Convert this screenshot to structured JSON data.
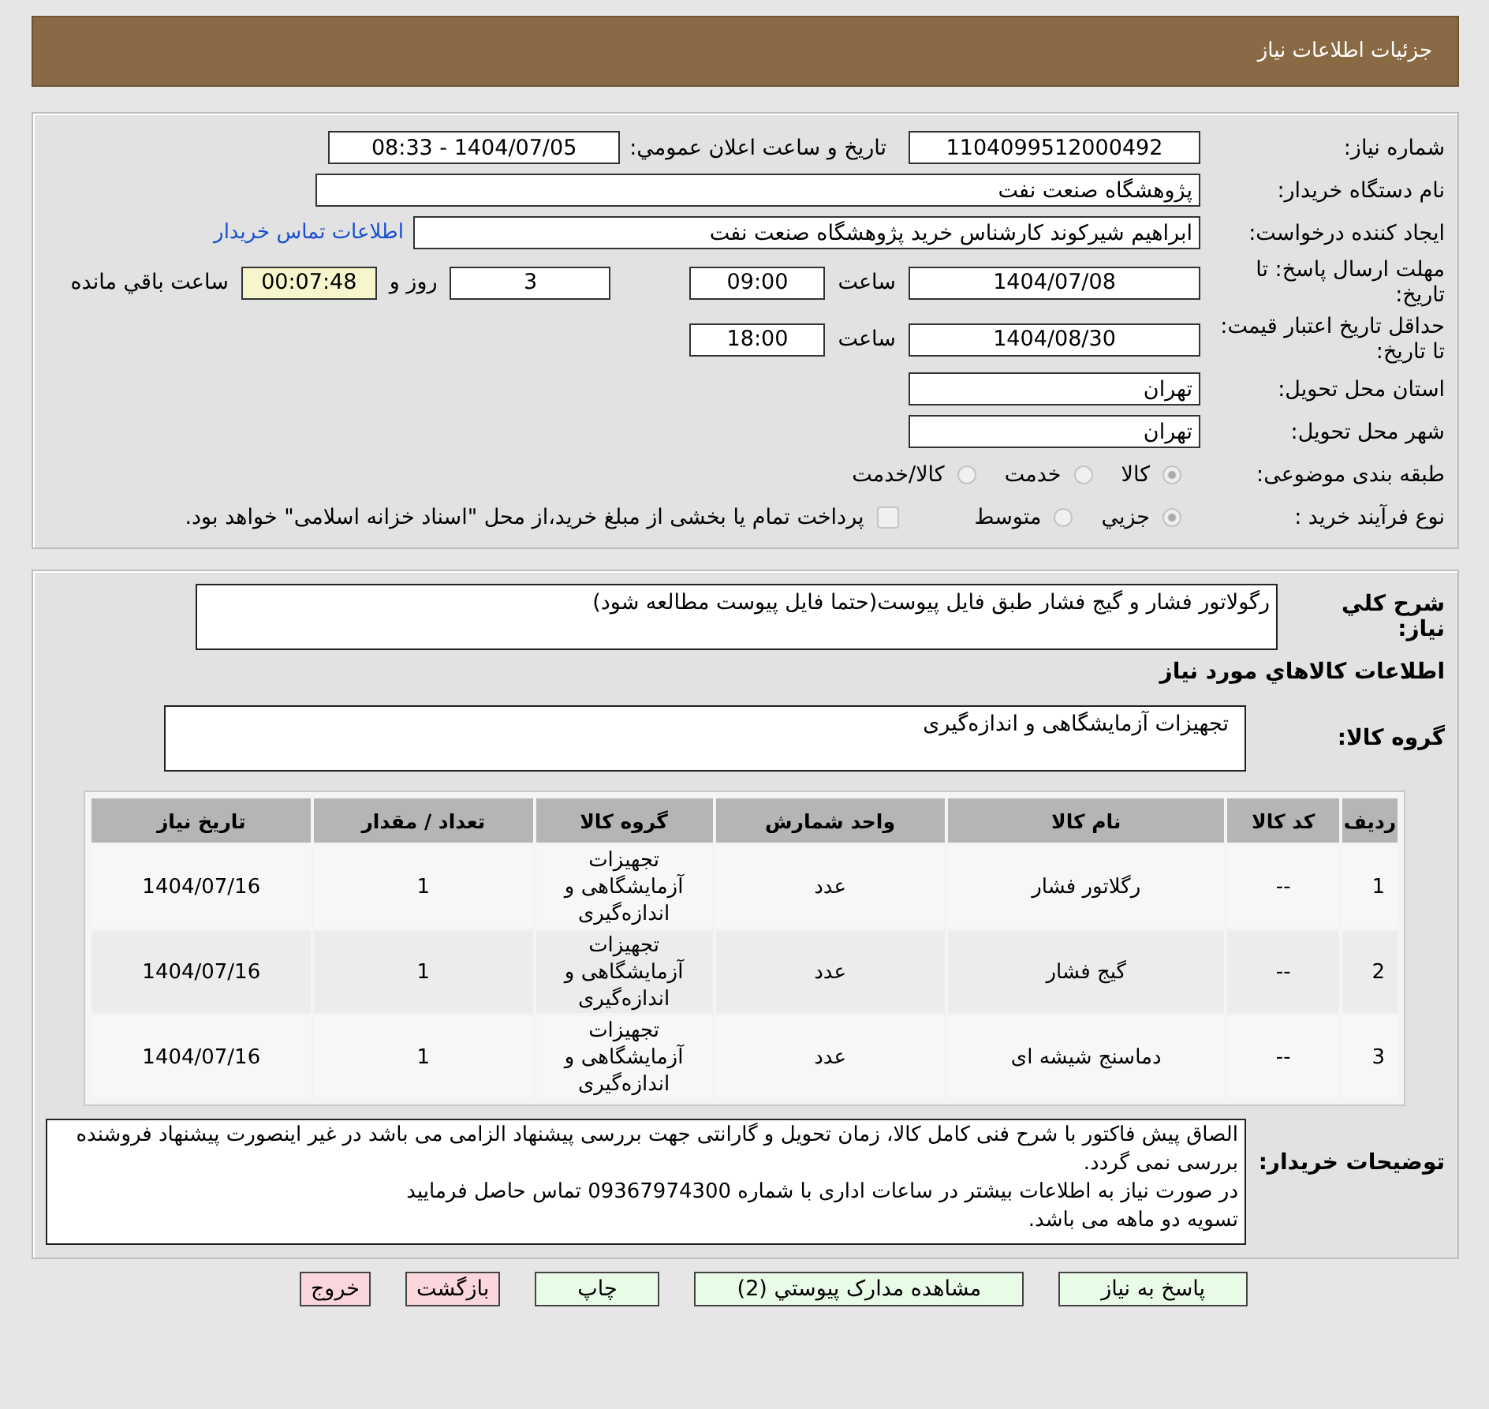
{
  "header": {
    "title": "جزئیات اطلاعات نیاز"
  },
  "form": {
    "need_number": {
      "label": "شماره نیاز:",
      "value": "1104099512000492"
    },
    "announce": {
      "label": "تاریخ و ساعت اعلان عمومي:",
      "value": "1404/07/05 - 08:33"
    },
    "buyer": {
      "label": "نام دستگاه خریدار:",
      "value": "پژوهشگاه صنعت نفت"
    },
    "requester": {
      "label": "ایجاد کننده درخواست:",
      "value": "ابراهیم شیرکوند کارشناس خرید پژوهشگاه صنعت نفت",
      "link": "اطلاعات تماس خريدار"
    },
    "deadline": {
      "label": "مهلت ارسال پاسخ: تا تاریخ:",
      "date": "1404/07/08",
      "time_label": "ساعت",
      "time": "09:00",
      "days": "3",
      "days_label": "روز و",
      "remaining": "00:07:48",
      "remaining_label": "ساعت باقي مانده"
    },
    "validity": {
      "label": "حداقل تاریخ اعتبار قیمت: تا تاریخ:",
      "date": "1404/08/30",
      "time_label": "ساعت",
      "time": "18:00"
    },
    "province": {
      "label": "استان محل تحویل:",
      "value": "تهران"
    },
    "city": {
      "label": "شهر محل تحویل:",
      "value": "تهران"
    },
    "category": {
      "label": "طبقه بندی موضوعی:",
      "options": [
        {
          "kind": "radio",
          "label": "كالا",
          "selected": true
        },
        {
          "kind": "radio",
          "label": "خدمت",
          "selected": false
        },
        {
          "kind": "radio",
          "label": "كالا/خدمت",
          "selected": false
        }
      ]
    },
    "purchase_type": {
      "label": "نوع فرآیند خرید :",
      "options": [
        {
          "kind": "radio",
          "label": "جزيي",
          "selected": true
        },
        {
          "kind": "radio",
          "label": "متوسط",
          "selected": false
        },
        {
          "kind": "checkbox",
          "label": "پرداخت تمام یا بخشی از مبلغ خرید،از محل \"اسناد خزانه اسلامی\" خواهد بود.",
          "checked": false
        }
      ]
    }
  },
  "details": {
    "description": {
      "label": "شرح کلي نياز:",
      "value": "رگولاتور فشار و گیج فشار طبق فایل پیوست(حتما فایل پیوست مطالعه شود)"
    },
    "goods_heading": "اطلاعات كالاهاي مورد نياز",
    "goods_group": {
      "label": "گروه کالا:",
      "value": "تجهیزات آزمایشگاهی و اندازه‌گیری"
    },
    "table": {
      "columns": [
        "ردیف",
        "کد کالا",
        "نام کالا",
        "واحد شمارش",
        "گروه کالا",
        "تعداد / مقدار",
        "تاریخ نیاز"
      ],
      "rows": [
        [
          "1",
          "--",
          "رگلاتور فشار",
          "عدد",
          "تجهیزات آزمایشگاهی و اندازه‌گیری",
          "1",
          "1404/07/16"
        ],
        [
          "2",
          "--",
          "گیج فشار",
          "عدد",
          "تجهیزات آزمایشگاهی و اندازه‌گیری",
          "1",
          "1404/07/16"
        ],
        [
          "3",
          "--",
          "دماسنج شیشه ای",
          "عدد",
          "تجهیزات آزمایشگاهی و اندازه‌گیری",
          "1",
          "1404/07/16"
        ]
      ]
    },
    "notes": {
      "label": "توضیحات خریدار:",
      "lines": [
        "الصاق پیش فاکتور با شرح فنی کامل کالا، زمان تحویل و گارانتی جهت بررسی پیشنهاد الزامی می باشد در غیر اینصورت پیشنهاد فروشنده بررسی نمی گردد.",
        "در صورت نیاز به اطلاعات بیشتر در ساعات اداری با شماره 09367974300 تماس حاصل فرمایید",
        "تسویه دو ماهه می باشد."
      ]
    }
  },
  "buttons": [
    {
      "label": "پاسخ به نیاز",
      "kind": "green"
    },
    {
      "label": "مشاهده مدارک پیوستي (2)",
      "kind": "green"
    },
    {
      "label": "چاپ",
      "kind": "green"
    },
    {
      "label": "بازگشت",
      "kind": "red"
    },
    {
      "label": "خروج",
      "kind": "red"
    }
  ]
}
